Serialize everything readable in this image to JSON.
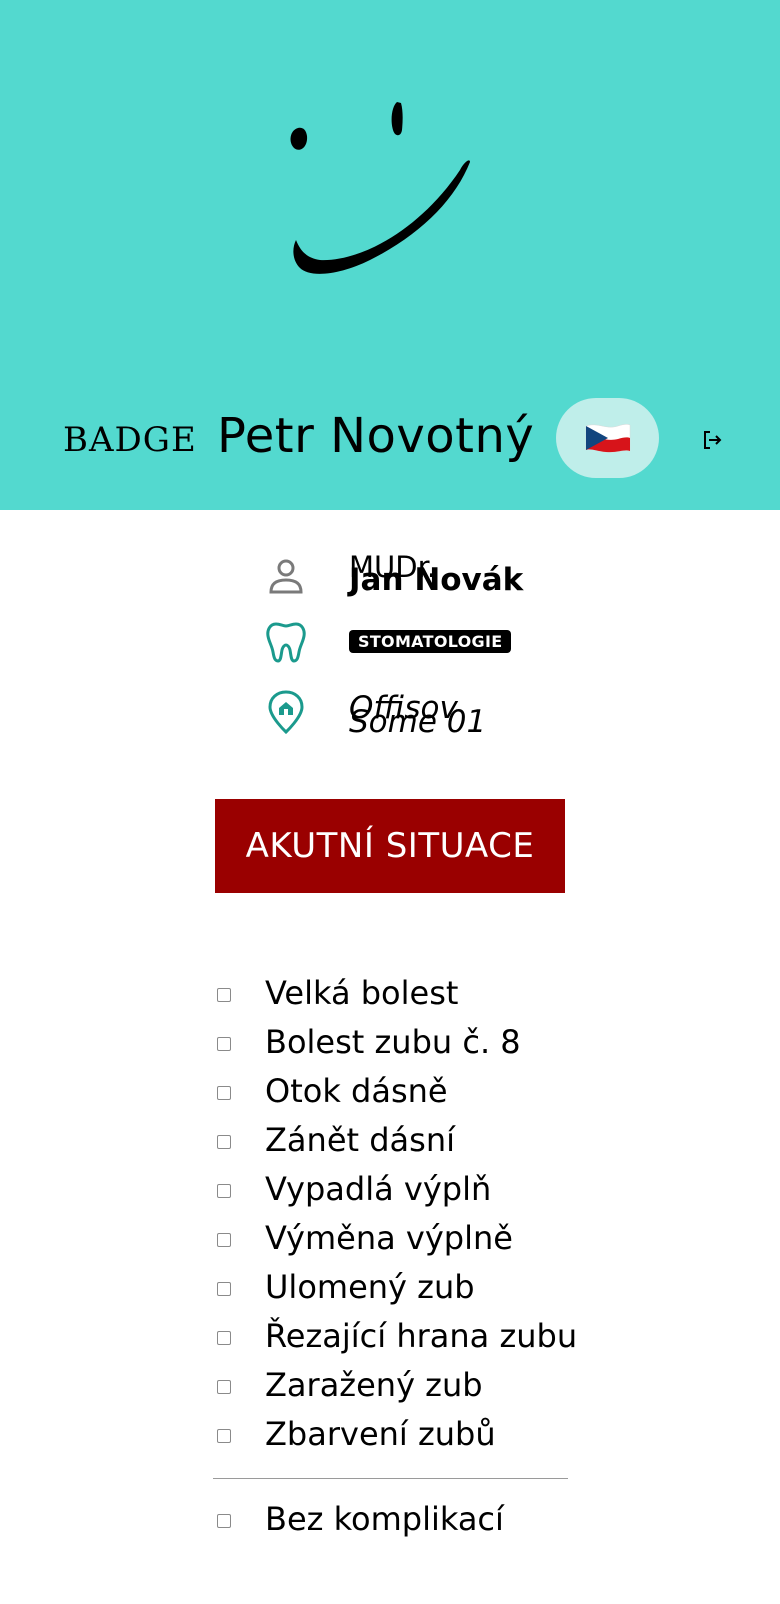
{
  "header": {
    "badge_text": "BADGE",
    "user_name": "Petr Novotný",
    "language_flag": "🇨🇿",
    "background_color": "#53d9cf",
    "logout_icon": "logout-icon"
  },
  "doctor": {
    "title": "MUDr.",
    "name": "Jan Novák",
    "specialty": "STOMATOLOGIE",
    "office_line1": "Offisov",
    "office_line2": "Some 01"
  },
  "acute_button": {
    "label": "AKUTNÍ SITUACE",
    "color": "#9a0000"
  },
  "symptoms": [
    {
      "label": "Velká bolest",
      "checked": false
    },
    {
      "label": "Bolest zubu č. 8",
      "checked": false
    },
    {
      "label": "Otok dásně",
      "checked": false
    },
    {
      "label": "Zánět dásní",
      "checked": false
    },
    {
      "label": "Vypadlá výplň",
      "checked": false
    },
    {
      "label": "Výměna výplně",
      "checked": false
    },
    {
      "label": "Ulomený zub",
      "checked": false
    },
    {
      "label": "Řezající hrana zubu",
      "checked": false
    },
    {
      "label": "Zaražený zub",
      "checked": false
    },
    {
      "label": "Zbarvení zubů",
      "checked": false
    }
  ],
  "no_complications": {
    "label": "Bez komplikací",
    "checked": false
  }
}
